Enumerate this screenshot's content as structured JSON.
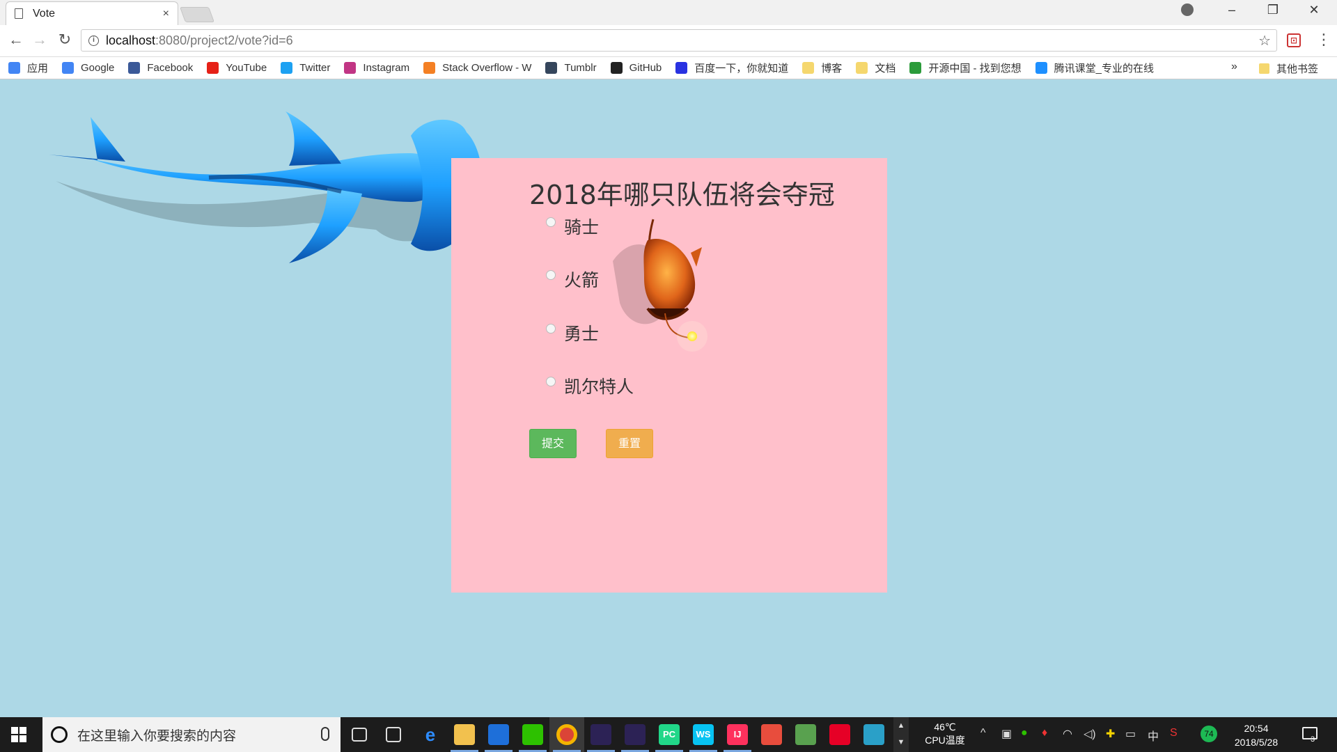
{
  "browser": {
    "tab_title": "Vote",
    "tab_close": "×",
    "url_host": "localhost",
    "url_path": ":8080/project2/vote?id=6",
    "window_controls": {
      "minimize": "–",
      "maximize": "❐",
      "close": "✕"
    }
  },
  "bookmarks": {
    "items": [
      {
        "label": "应用",
        "icon": "apps-grid-icon",
        "color": "#4285f4"
      },
      {
        "label": "Google",
        "icon": "google-icon",
        "color": "#4285f4"
      },
      {
        "label": "Facebook",
        "icon": "facebook-icon",
        "color": "#3b5998"
      },
      {
        "label": "YouTube",
        "icon": "youtube-icon",
        "color": "#e62117"
      },
      {
        "label": "Twitter",
        "icon": "twitter-icon",
        "color": "#1da1f2"
      },
      {
        "label": "Instagram",
        "icon": "instagram-icon",
        "color": "#c13584"
      },
      {
        "label": "Stack Overflow - W",
        "icon": "stackoverflow-icon",
        "color": "#f48024"
      },
      {
        "label": "Tumblr",
        "icon": "tumblr-icon",
        "color": "#35465c"
      },
      {
        "label": "GitHub",
        "icon": "github-icon",
        "color": "#222222"
      },
      {
        "label": "百度一下，你就知道",
        "icon": "baidu-icon",
        "color": "#2932e1"
      },
      {
        "label": "博客",
        "icon": "folder-icon",
        "color": "#f5d76e"
      },
      {
        "label": "文档",
        "icon": "folder-icon",
        "color": "#f5d76e"
      },
      {
        "label": "开源中国 - 找到您想",
        "icon": "oschina-icon",
        "color": "#2b9b3a"
      },
      {
        "label": "腾讯课堂_专业的在线",
        "icon": "tencent-class-icon",
        "color": "#1e90ff"
      }
    ],
    "more": "»",
    "other": "其他书签"
  },
  "vote": {
    "title": "2018年哪只队伍将会夺冠",
    "options": [
      "骑士",
      "火箭",
      "勇士",
      "凯尔特人"
    ],
    "submit_label": "提交",
    "reset_label": "重置"
  },
  "taskbar": {
    "search_placeholder": "在这里输入你要搜索的内容",
    "cpu_temp": "46℃",
    "cpu_label": "CPU温度",
    "ime": "中",
    "badge": "74",
    "time": "20:54",
    "date": "2018/5/28",
    "notifications": "3",
    "apps": [
      {
        "name": "task-view-icon",
        "label": "",
        "color": "#1c1c1c"
      },
      {
        "name": "store-icon",
        "label": "",
        "color": "#1c1c1c"
      },
      {
        "name": "edge-icon",
        "label": "e",
        "color": "#1c1c1c"
      },
      {
        "name": "file-explorer-icon",
        "label": "",
        "color": "#f2c14e"
      },
      {
        "name": "qq-icon",
        "label": "",
        "color": "#1e6fd9"
      },
      {
        "name": "wechat-icon",
        "label": "",
        "color": "#2dc100"
      },
      {
        "name": "chrome-icon",
        "label": "",
        "color": "#db4437"
      },
      {
        "name": "eclipse-icon",
        "label": "",
        "color": "#2c2255"
      },
      {
        "name": "eclipse-icon-2",
        "label": "",
        "color": "#2c2255"
      },
      {
        "name": "pycharm-icon",
        "label": "PC",
        "color": "#21d789"
      },
      {
        "name": "webstorm-icon",
        "label": "WS",
        "color": "#07c3f2"
      },
      {
        "name": "intellij-icon",
        "label": "IJ",
        "color": "#fe315d"
      },
      {
        "name": "app-colorful-icon",
        "label": "",
        "color": "#e84d3d"
      },
      {
        "name": "notepad-icon",
        "label": "",
        "color": "#59a14f"
      },
      {
        "name": "netease-music-icon",
        "label": "",
        "color": "#e60026"
      },
      {
        "name": "vpn-icon",
        "label": "",
        "color": "#2aa0c8"
      }
    ]
  }
}
